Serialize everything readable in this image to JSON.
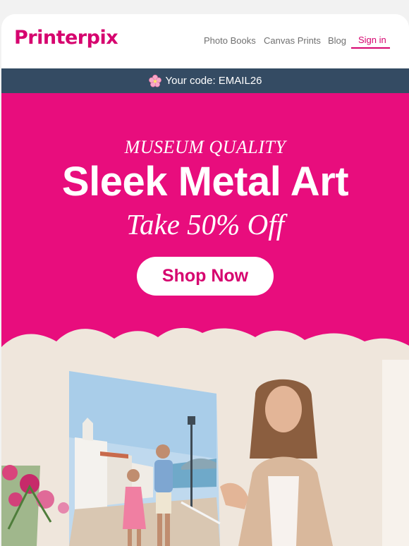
{
  "header": {
    "logo_text": "Printerpix",
    "nav": [
      {
        "label": "Photo Books"
      },
      {
        "label": "Canvas Prints"
      },
      {
        "label": "Blog"
      },
      {
        "label": "Sign in"
      }
    ]
  },
  "promo_bar": {
    "icon": "cherry-blossom-icon",
    "text": "Your code: EMAIL26"
  },
  "hero": {
    "kicker": "MUSEUM QUALITY",
    "headline": "Sleek Metal Art",
    "subhead": "Take 50% Off",
    "cta_label": "Shop Now"
  },
  "colors": {
    "brand_pink": "#d6046f",
    "hero_pink": "#e80d7d",
    "code_bar": "#344b63"
  },
  "image": {
    "description": "woman holding a large metal print of a couple walking on a seaside promenade"
  }
}
